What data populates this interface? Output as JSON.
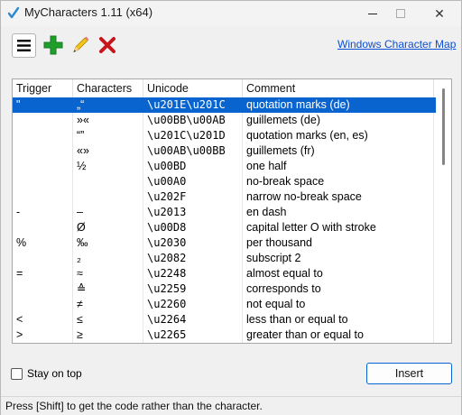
{
  "window": {
    "title": "MyCharacters 1.11 (x64)",
    "minimize": "—",
    "maximize": "",
    "close": "✕"
  },
  "toolbar": {
    "menu_icon": "hamburger-icon",
    "add_icon": "plus-icon",
    "edit_icon": "pencil-icon",
    "delete_icon": "x-icon",
    "link_label": "Windows Character Map"
  },
  "table": {
    "headers": [
      "Trigger",
      "Characters",
      "Unicode",
      "Comment"
    ],
    "rows": [
      {
        "trigger": "\"",
        "characters": "„“",
        "unicode": "\\u201E\\u201C",
        "comment": "quotation marks (de)",
        "selected": true
      },
      {
        "trigger": "",
        "characters": "»«",
        "unicode": "\\u00BB\\u00AB",
        "comment": "guillemets (de)"
      },
      {
        "trigger": "",
        "characters": "“”",
        "unicode": "\\u201C\\u201D",
        "comment": "quotation marks (en, es)"
      },
      {
        "trigger": "",
        "characters": "«»",
        "unicode": "\\u00AB\\u00BB",
        "comment": "guillemets (fr)"
      },
      {
        "trigger": "",
        "characters": "½",
        "unicode": "\\u00BD",
        "comment": "one half"
      },
      {
        "trigger": "",
        "characters": "",
        "unicode": "\\u00A0",
        "comment": "no-break space"
      },
      {
        "trigger": "",
        "characters": "",
        "unicode": "\\u202F",
        "comment": "narrow no-break space"
      },
      {
        "trigger": "-",
        "characters": "–",
        "unicode": "\\u2013",
        "comment": "en dash"
      },
      {
        "trigger": "",
        "characters": "Ø",
        "unicode": "\\u00D8",
        "comment": "capital letter O with stroke"
      },
      {
        "trigger": "%",
        "characters": "‰",
        "unicode": "\\u2030",
        "comment": "per thousand"
      },
      {
        "trigger": "",
        "characters": "₂",
        "unicode": "\\u2082",
        "comment": "subscript 2"
      },
      {
        "trigger": "=",
        "characters": "≈",
        "unicode": "\\u2248",
        "comment": "almost equal to"
      },
      {
        "trigger": "",
        "characters": "≙",
        "unicode": "\\u2259",
        "comment": "corresponds to"
      },
      {
        "trigger": "",
        "characters": "≠",
        "unicode": "\\u2260",
        "comment": "not equal to"
      },
      {
        "trigger": "<",
        "characters": "≤",
        "unicode": "\\u2264",
        "comment": "less than or equal to"
      },
      {
        "trigger": ">",
        "characters": "≥",
        "unicode": "\\u2265",
        "comment": "greater than or equal to"
      }
    ]
  },
  "controls": {
    "stay_on_top_label": "Stay on top",
    "stay_on_top_checked": false,
    "insert_label": "Insert"
  },
  "status": {
    "text": "Press [Shift] to get the code rather than the character."
  },
  "colors": {
    "selection": "#0a64d0",
    "link": "#0b4fd6",
    "add_green": "#1f9e2c",
    "delete_red": "#c8141b"
  }
}
